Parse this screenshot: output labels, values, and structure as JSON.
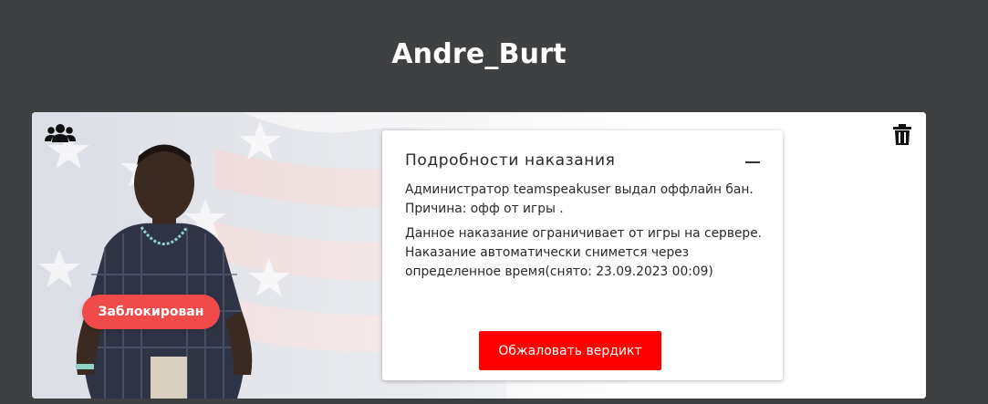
{
  "header": {
    "player_name": "Andre_Burt"
  },
  "card": {
    "group_icon": "users-group-icon",
    "delete_icon": "trash-icon",
    "background": "us-flag-faded",
    "status_badge": "Заблокирован",
    "details": {
      "title": "Подробности наказания",
      "collapse_icon": "minus-icon",
      "admin_line": "Администратор teamspeakuser выдал оффлайн бан.",
      "reason_line": "Причина: офф от игры .",
      "notice": "Данное наказание ограничивает от игры на сервере. Наказание автоматически снимется через определенное время(снято: 23.09.2023 00:09)",
      "appeal_button": "Обжаловать вердикт"
    }
  },
  "colors": {
    "page_bg": "#3f4042",
    "badge": "#f04a4a",
    "appeal_button": "#ff0000"
  }
}
